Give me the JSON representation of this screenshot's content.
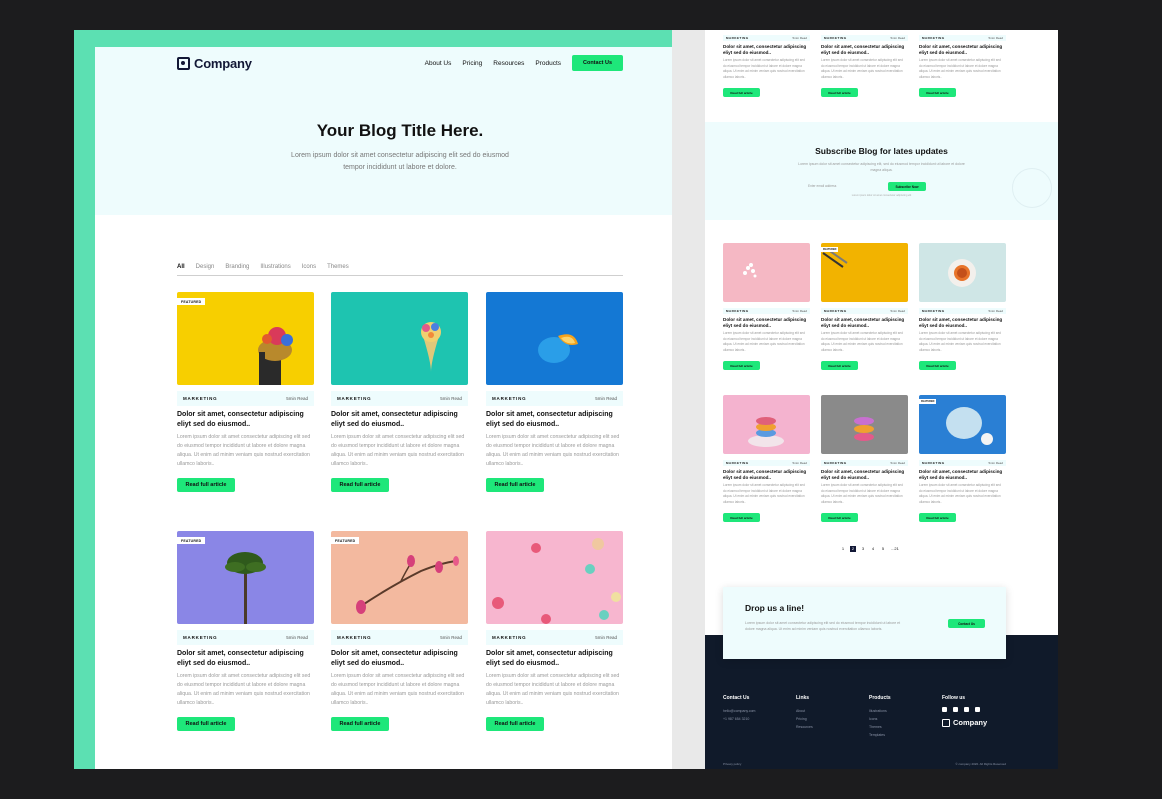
{
  "front": {
    "brand": "Company",
    "nav": {
      "about": "About Us",
      "pricing": "Pricing",
      "resources": "Resources",
      "products": "Products",
      "contact": "Contact Us"
    },
    "hero": {
      "title": "Your Blog Title Here.",
      "subtitle": "Lorem ipsum dolor sit amet consectetur adipiscing elit sed do eiusmod tempor incididunt ut labore et dolore."
    },
    "filters": [
      "All",
      "Design",
      "Branding",
      "Illustrations",
      "Icons",
      "Themes"
    ],
    "cards": [
      {
        "badge": "FEATURED",
        "category": "MARKETING",
        "read": "5min Read",
        "title": "Dolor sit amet, consectetur adipiscing eliyt sed do eiusmod..",
        "text": "Lorem ipsum dolor sit amet consectetur adipiscing elit sed do eiusmod tempor incididunt ut labore et dolore magna aliqua. Ut enim ad minim veniam quis nostrud exercitation ullamco laboris..",
        "button": "Read full article",
        "bg": "#f7cf00"
      },
      {
        "badge": "",
        "category": "MARKETING",
        "read": "5min Read",
        "title": "Dolor sit amet, consectetur adipiscing eliyt sed do eiusmod..",
        "text": "Lorem ipsum dolor sit amet consectetur adipiscing elit sed do eiusmod tempor incididunt ut labore et dolore magna aliqua. Ut enim ad minim veniam quis nostrud exercitation ullamco laboris..",
        "button": "Read full article",
        "bg": "#1ec4b0"
      },
      {
        "badge": "",
        "category": "MARKETING",
        "read": "5min Read",
        "title": "Dolor sit amet, consectetur adipiscing eliyt sed do eiusmod..",
        "text": "Lorem ipsum dolor sit amet consectetur adipiscing elit sed do eiusmod tempor incididunt ut labore et dolore magna aliqua. Ut enim ad minim veniam quis nostrud exercitation ullamco laboris..",
        "button": "Read full article",
        "bg": "#1478d4"
      },
      {
        "badge": "FEATURED",
        "category": "MARKETING",
        "read": "5min Read",
        "title": "Dolor sit amet, consectetur adipiscing eliyt sed do eiusmod..",
        "text": "Lorem ipsum dolor sit amet consectetur adipiscing elit sed do eiusmod tempor incididunt ut labore et dolore magna aliqua. Ut enim ad minim veniam quis nostrud exercitation ullamco laboris..",
        "button": "Read full article",
        "bg": "#8a86e6"
      },
      {
        "badge": "FEATURED",
        "category": "MARKETING",
        "read": "5min Read",
        "title": "Dolor sit amet, consectetur adipiscing eliyt sed do eiusmod..",
        "text": "Lorem ipsum dolor sit amet consectetur adipiscing elit sed do eiusmod tempor incididunt ut labore et dolore magna aliqua. Ut enim ad minim veniam quis nostrud exercitation ullamco laboris..",
        "button": "Read full article",
        "bg": "#f3b99f"
      },
      {
        "badge": "",
        "category": "MARKETING",
        "read": "5min Read",
        "title": "Dolor sit amet, consectetur adipiscing eliyt sed do eiusmod..",
        "text": "Lorem ipsum dolor sit amet consectetur adipiscing elit sed do eiusmod tempor incididunt ut labore et dolore magna aliqua. Ut enim ad minim veniam quis nostrud exercitation ullamco laboris..",
        "button": "Read full article",
        "bg": "#f7b6cf"
      }
    ]
  },
  "back": {
    "top_cards": [
      {
        "category": "MARKETING",
        "read": "5min Read",
        "title": "Dolor sit amet, consectetur adipiscing eliyt sed do eiusmod..",
        "text": "Lorem ipsum dolor sit amet consectetur adipiscing elit sed do eiusmod tempor incididunt ut labore et dolore magna aliqua. Ut enim ad minim veniam quis nostrud exercitation ullamco laboris..",
        "button": "Read full article"
      },
      {
        "category": "MARKETING",
        "read": "5min Read",
        "title": "Dolor sit amet, consectetur adipiscing eliyt sed do eiusmod..",
        "text": "Lorem ipsum dolor sit amet consectetur adipiscing elit sed do eiusmod tempor incididunt ut labore et dolore magna aliqua. Ut enim ad minim veniam quis nostrud exercitation ullamco laboris..",
        "button": "Read full article"
      },
      {
        "category": "MARKETING",
        "read": "5min Read",
        "title": "Dolor sit amet, consectetur adipiscing eliyt sed do eiusmod..",
        "text": "Lorem ipsum dolor sit amet consectetur adipiscing elit sed do eiusmod tempor incididunt ut labore et dolore magna aliqua. Ut enim ad minim veniam quis nostrud exercitation ullamco laboris..",
        "button": "Read full article"
      }
    ],
    "subscribe": {
      "title": "Subscribe Blog for lates updates",
      "text": "Lorem ipsum dolor sit amet consectetur adipiscing elit, sed do eiusmod tempor incididunt ut labore et dolore magna aliqua.",
      "placeholder": "Enter email address",
      "button": "Subscribe Now",
      "note": "Lorem ipsum dolor sit amet consectetur adipiscing elit"
    },
    "grid_cards": [
      {
        "badge": "",
        "category": "MARKETING",
        "read": "5min Read",
        "title": "Dolor sit amet, consectetur adipiscing eliyt sed do eiusmod..",
        "text": "Lorem ipsum dolor sit amet consectetur adipiscing elit sed do eiusmod tempor incididunt ut labore et dolore magna aliqua. Ut enim ad minim veniam quis nostrud exercitation ullamco laboris..",
        "button": "Read full article",
        "bg": "#f5b8c4"
      },
      {
        "badge": "FEATURED",
        "category": "MARKETING",
        "read": "5min Read",
        "title": "Dolor sit amet, consectetur adipiscing eliyt sed do eiusmod..",
        "text": "Lorem ipsum dolor sit amet consectetur adipiscing elit sed do eiusmod tempor incididunt ut labore et dolore magna aliqua. Ut enim ad minim veniam quis nostrud exercitation ullamco laboris..",
        "button": "Read full article",
        "bg": "#f2b300"
      },
      {
        "badge": "",
        "category": "MARKETING",
        "read": "5min Read",
        "title": "Dolor sit amet, consectetur adipiscing eliyt sed do eiusmod..",
        "text": "Lorem ipsum dolor sit amet consectetur adipiscing elit sed do eiusmod tempor incididunt ut labore et dolore magna aliqua. Ut enim ad minim veniam quis nostrud exercitation ullamco laboris..",
        "button": "Read full article",
        "bg": "#cfe6e6"
      },
      {
        "badge": "",
        "category": "MARKETING",
        "read": "5min Read",
        "title": "Dolor sit amet, consectetur adipiscing eliyt sed do eiusmod..",
        "text": "Lorem ipsum dolor sit amet consectetur adipiscing elit sed do eiusmod tempor incididunt ut labore et dolore magna aliqua. Ut enim ad minim veniam quis nostrud exercitation ullamco laboris..",
        "button": "Read full article",
        "bg": "#f4b3cf"
      },
      {
        "badge": "",
        "category": "MARKETING",
        "read": "5min Read",
        "title": "Dolor sit amet, consectetur adipiscing eliyt sed do eiusmod..",
        "text": "Lorem ipsum dolor sit amet consectetur adipiscing elit sed do eiusmod tempor incididunt ut labore et dolore magna aliqua. Ut enim ad minim veniam quis nostrud exercitation ullamco laboris..",
        "button": "Read full article",
        "bg": "#8a8a8a"
      },
      {
        "badge": "FEATURED",
        "category": "MARKETING",
        "read": "5min Read",
        "title": "Dolor sit amet, consectetur adipiscing eliyt sed do eiusmod..",
        "text": "Lorem ipsum dolor sit amet consectetur adipiscing elit sed do eiusmod tempor incididunt ut labore et dolore magna aliqua. Ut enim ad minim veniam quis nostrud exercitation ullamco laboris..",
        "button": "Read full article",
        "bg": "#2a7fd4"
      }
    ],
    "pagination": [
      "1",
      "2",
      "3",
      "4",
      "5",
      "...21"
    ],
    "cta": {
      "title": "Drop us a line!",
      "text": "Lorem ipsum dolor sit amet consectetur adipiscing elit sed do eiusmod tempor incididunt ut labore et dolore magna aliqua. Ut enim ad minim veniam quis nostrud exercitation ullamco laboris.",
      "button": "Contact Us"
    },
    "footer": {
      "contact": {
        "heading": "Contact Us",
        "email": "hello@company.com",
        "phone": "+1 987 654 3210"
      },
      "links": {
        "heading": "Links",
        "items": [
          "About",
          "Pricing",
          "Resources"
        ]
      },
      "products": {
        "heading": "Products",
        "items": [
          "Illustrations",
          "Icons",
          "Themes",
          "Templates"
        ]
      },
      "follow": {
        "heading": "Follow us",
        "brand": "Company"
      },
      "bottom_left": "Privacy policy",
      "bottom_right": "© company 2020. All Rights Reserved"
    }
  },
  "colors": {
    "accent": "#1ee77a",
    "frame": "#5ce0b2",
    "hero_bg": "#eefcfd",
    "footer": "#101a2a",
    "dark": "#121836"
  }
}
